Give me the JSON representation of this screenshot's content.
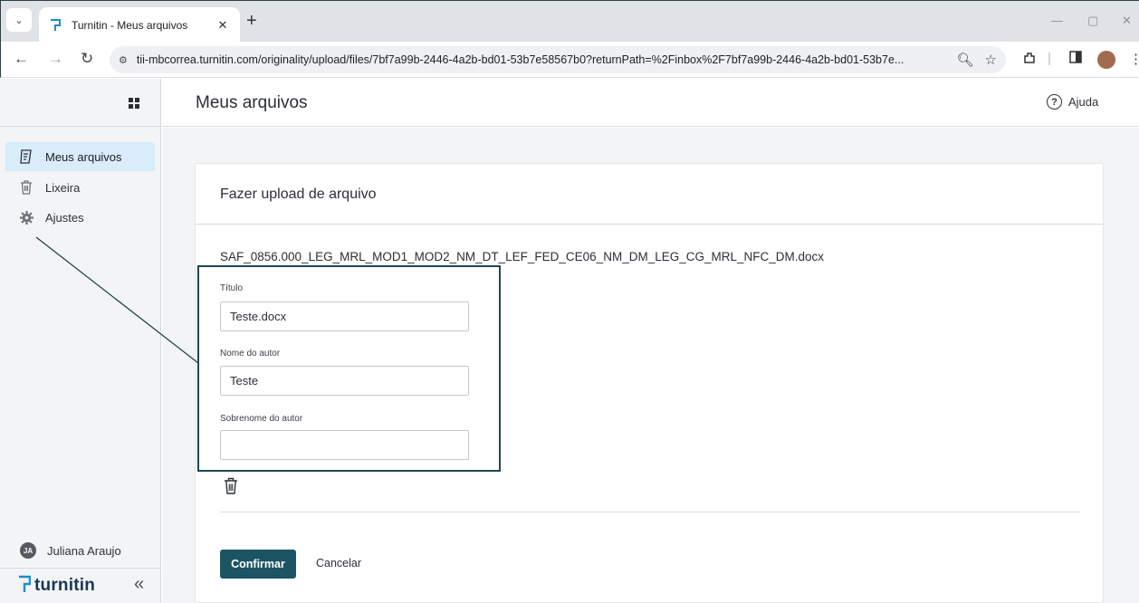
{
  "browser": {
    "tab_title": "Turnitin - Meus arquivos",
    "url": "tii-mbcorrea.turnitin.com/originality/upload/files/7bf7a99b-2446-4a2b-bd01-53b7e58567b0?returnPath=%2Finbox%2F7bf7a99b-2446-4a2b-bd01-53b7e..."
  },
  "sidebar": {
    "items": [
      {
        "label": "Meus arquivos",
        "icon": "files-icon",
        "active": true
      },
      {
        "label": "Lixeira",
        "icon": "trash-icon",
        "active": false
      },
      {
        "label": "Ajustes",
        "icon": "gear-icon",
        "active": false
      }
    ],
    "user": {
      "initials": "JA",
      "name": "Juliana Araujo"
    },
    "brand": "turnitin",
    "collapse_glyph": "«"
  },
  "header": {
    "title": "Meus arquivos",
    "help_label": "Ajuda"
  },
  "upload": {
    "card_title": "Fazer upload de arquivo",
    "file_name": "SAF_0856.000_LEG_MRL_MOD1_MOD2_NM_DT_LEF_FED_CE06_NM_DM_LEG_CG_MRL_NFC_DM.docx",
    "fields": [
      {
        "label": "Título",
        "value": "Teste.docx"
      },
      {
        "label": "Nome do autor",
        "value": "Teste"
      },
      {
        "label": "Sobrenome do autor",
        "value": ""
      }
    ],
    "confirm_label": "Confirmar",
    "cancel_label": "Cancelar"
  },
  "colors": {
    "accent": "#1c5463",
    "sidebar_active": "#d8ecf9",
    "annotation": "#1f4652"
  }
}
